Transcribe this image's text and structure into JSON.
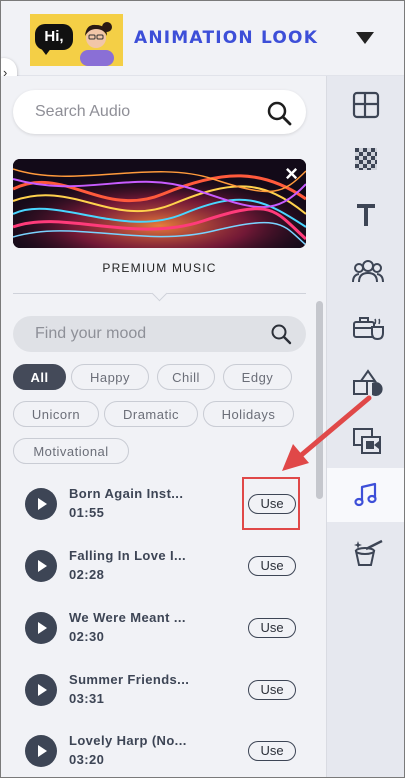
{
  "header": {
    "logo_text": "Hi,",
    "title": "ANIMATION LOOK"
  },
  "search": {
    "placeholder": "Search Audio"
  },
  "banner": {
    "label": "PREMIUM MUSIC",
    "close": "×"
  },
  "mood": {
    "placeholder": "Find your mood"
  },
  "filters": [
    {
      "label": "All",
      "active": true
    },
    {
      "label": "Happy",
      "active": false
    },
    {
      "label": "Chill",
      "active": false
    },
    {
      "label": "Edgy",
      "active": false
    },
    {
      "label": "Unicorn",
      "active": false
    },
    {
      "label": "Dramatic",
      "active": false
    },
    {
      "label": "Holidays",
      "active": false
    },
    {
      "label": "Motivational",
      "active": false
    }
  ],
  "tracks": [
    {
      "title": "Born Again Inst...",
      "duration": "01:55",
      "action": "Use"
    },
    {
      "title": "Falling In Love I...",
      "duration": "02:28",
      "action": "Use"
    },
    {
      "title": "We Were Meant ...",
      "duration": "02:30",
      "action": "Use"
    },
    {
      "title": "Summer Friends...",
      "duration": "03:31",
      "action": "Use"
    },
    {
      "title": "Lovely Harp (No...",
      "duration": "03:20",
      "action": "Use"
    }
  ],
  "sidebar": {
    "items": [
      "layout-icon",
      "background-icon",
      "text-icon",
      "characters-icon",
      "props-icon",
      "shapes-icon",
      "media-icon",
      "music-icon",
      "effects-icon"
    ],
    "active": "music-icon"
  },
  "colors": {
    "accent": "#3d4fd8",
    "annotation": "#e04848",
    "panel": "#f1f2f6",
    "dark": "#3d4555"
  }
}
